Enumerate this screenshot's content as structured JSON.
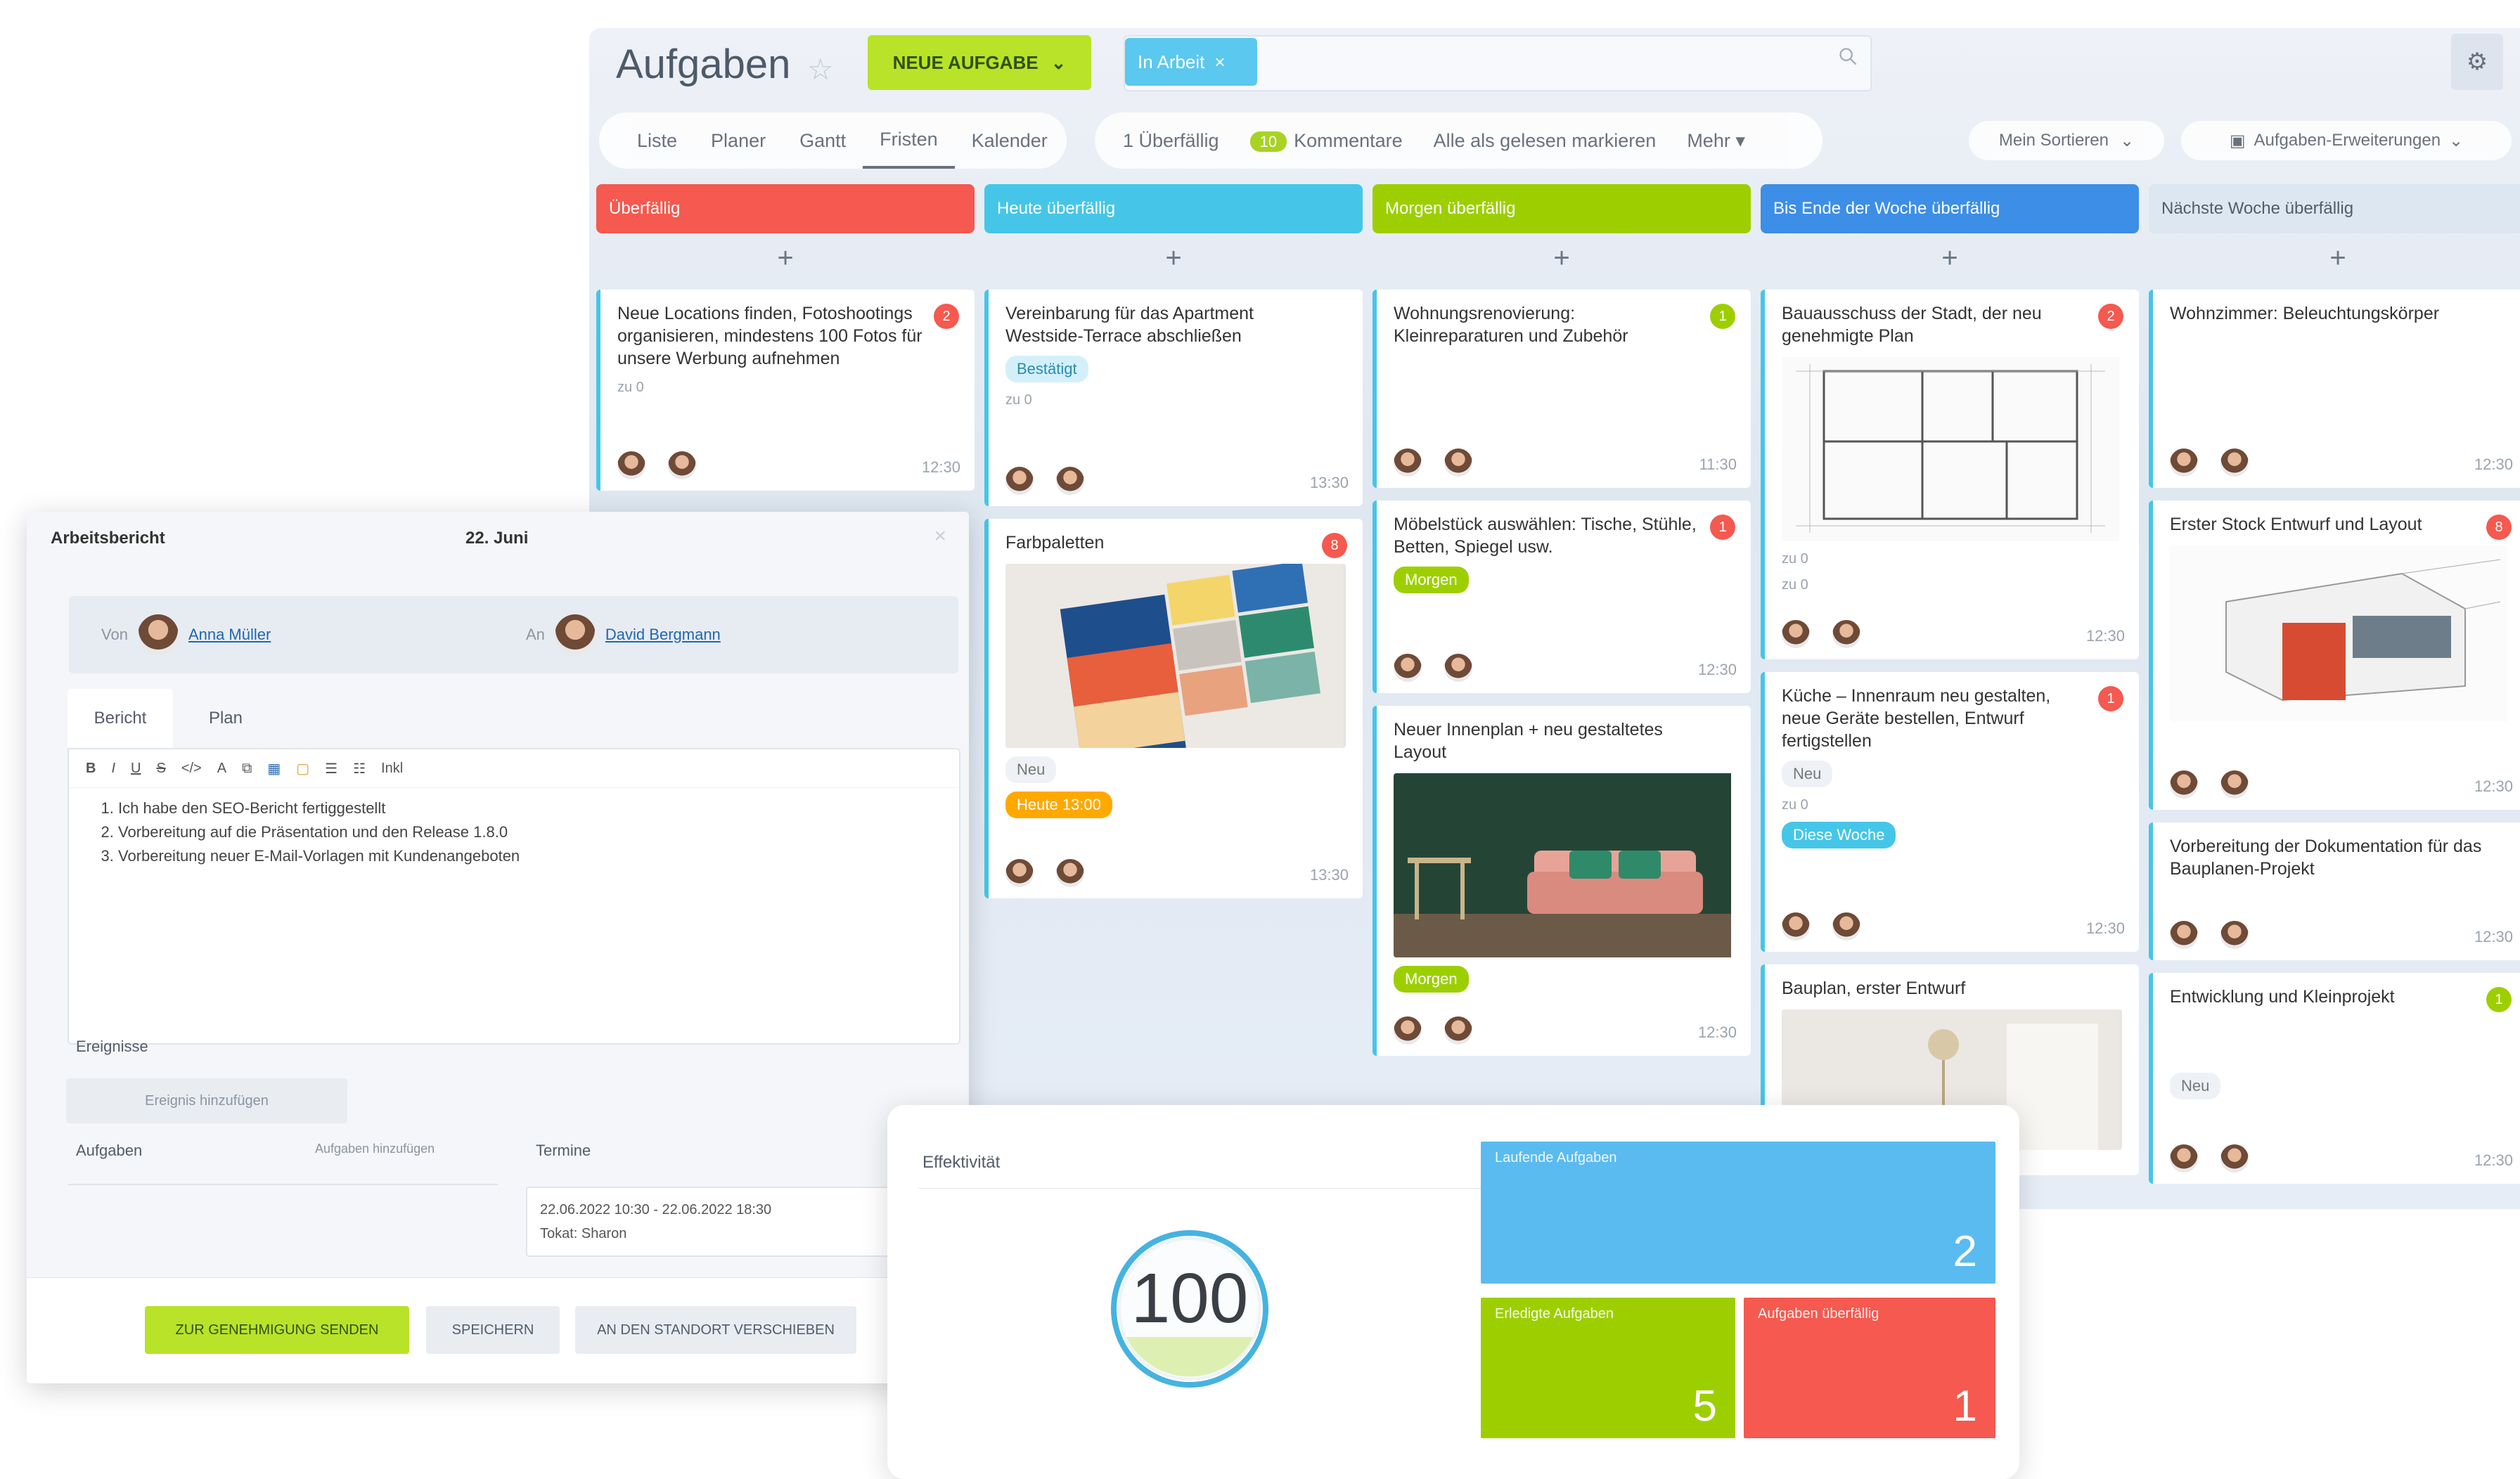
{
  "header": {
    "title": "Aufgaben",
    "new_task": "NEUE AUFGABE",
    "search_chip": "In Arbeit"
  },
  "views": [
    "Liste",
    "Planer",
    "Gantt",
    "Fristen",
    "Kalender"
  ],
  "filters": {
    "overdue": "1 Überfällig",
    "comments_count": "10",
    "comments": "Kommentare",
    "mark_all": "Alle als gelesen markieren",
    "more": "Mehr"
  },
  "sort_label": "Mein Sortieren",
  "extensions_label": "Aufgaben-Erweiterungen",
  "colors": {
    "red": "#f5594f",
    "cyan": "#45c6e8",
    "green": "#9dcf00",
    "blue": "#3d8ee6",
    "orange": "#ffa900"
  },
  "columns": [
    {
      "title": "Überfällig",
      "color": "#f5594f",
      "cards": [
        {
          "title": "Neue Locations finden, Fotoshootings organisieren, mindestens 100 Fotos für unsere Werbung aufnehmen",
          "count": "2",
          "count_color": "#f5594f",
          "meta": "zu 0",
          "time": "12:30"
        }
      ]
    },
    {
      "title": "Heute überfällig",
      "color": "#45c6e8",
      "cards": [
        {
          "title": "Vereinbarung für das Apartment Westside-Terrace abschließen",
          "tag": "Bestätigt",
          "meta": "zu 0",
          "time": "13:30"
        },
        {
          "title": "Farbpaletten",
          "count": "8",
          "count_color": "#f5594f",
          "tag": "Neu",
          "tag2": "Heute 13:00",
          "time": "13:30"
        }
      ]
    },
    {
      "title": "Morgen überfällig",
      "color": "#9dcf00",
      "cards": [
        {
          "title": "Wohnungsrenovierung: Kleinreparaturen und Zubehör",
          "count": "1",
          "count_color": "#9dcf00",
          "time": "11:30"
        },
        {
          "title": "Möbelstück auswählen: Tische, Stühle, Betten, Spiegel usw.",
          "count": "1",
          "count_color": "#f5594f",
          "tag": "Morgen",
          "time": "12:30"
        },
        {
          "title": "Neuer Innenplan + neu gestaltetes Layout",
          "tag": "Morgen",
          "time": "12:30"
        }
      ]
    },
    {
      "title": "Bis Ende der Woche überfällig",
      "color": "#3d8ee6",
      "cards": [
        {
          "title": "Bauausschuss der Stadt, der neu genehmigte Plan",
          "count": "2",
          "count_color": "#f5594f",
          "meta": "zu 0",
          "meta2": "zu 0",
          "time": "12:30"
        },
        {
          "title": "Küche – Innenraum neu gestalten, neue Geräte bestellen, Entwurf fertigstellen",
          "count": "1",
          "count_color": "#f5594f",
          "tag": "Neu",
          "meta": "zu 0",
          "tag2": "Diese Woche",
          "time": "12:30"
        },
        {
          "title": "Bauplan, erster Entwurf"
        }
      ]
    },
    {
      "title": "Nächste Woche überfällig",
      "color": "#dde7f2",
      "cards": [
        {
          "title": "Wohnzimmer: Beleuchtungskörper",
          "time": "12:30"
        },
        {
          "title": "Erster Stock Entwurf und Layout",
          "count": "8",
          "count_color": "#f5594f",
          "time": "12:30"
        },
        {
          "title": "Vorbereitung der Dokumentation für das Bauplanen-Projekt",
          "time": "12:30"
        },
        {
          "title": "Entwicklung und Kleinprojekt",
          "count": "1",
          "count_color": "#9dcf00",
          "tag": "Neu",
          "time": "12:30"
        }
      ]
    }
  ],
  "form": {
    "title": "Arbeitsbericht",
    "date": "22. Juni",
    "from_label": "Von",
    "from_name": "Anna Müller",
    "to_label": "An",
    "to_name": "David Bergmann",
    "tabs": [
      "Bericht",
      "Plan"
    ],
    "toolbar": [
      "B",
      "I",
      "U",
      "S",
      "</>",
      "A",
      "⧉",
      "▦",
      "▢",
      "☰",
      "☷",
      "Inkl"
    ],
    "items": [
      "Ich habe den SEO-Bericht fertiggestellt",
      "Vorbereitung auf die Präsentation und den Release 1.8.0",
      "Vorbereitung neuer E-Mail-Vorlagen mit Kundenangeboten"
    ],
    "events_label": "Ereignisse",
    "events_button": "Ereignis hinzufügen",
    "tasks_label": "Aufgaben",
    "tasks_action": "Aufgaben hinzufügen",
    "terms_label": "Termine",
    "term_line1": "22.06.2022 10:30 - 22.06.2022 18:30",
    "term_line2": "Tokat: Sharon",
    "btn_send": "ZUR GENEHMIGUNG SENDEN",
    "btn_save": "SPEICHERN",
    "btn_later": "AN DEN STANDORT VERSCHIEBEN"
  },
  "dashboard": {
    "title": "Effektivität",
    "score": "100",
    "score_fraction": 1.0,
    "tiles": [
      {
        "label": "Laufende Aufgaben",
        "value": "2",
        "color": "#5abbf0"
      },
      {
        "label": "Erledigte Aufgaben",
        "value": "5",
        "color": "#9dcf00"
      },
      {
        "label": "Aufgaben überfällig",
        "value": "1",
        "color": "#f5594f"
      }
    ]
  }
}
